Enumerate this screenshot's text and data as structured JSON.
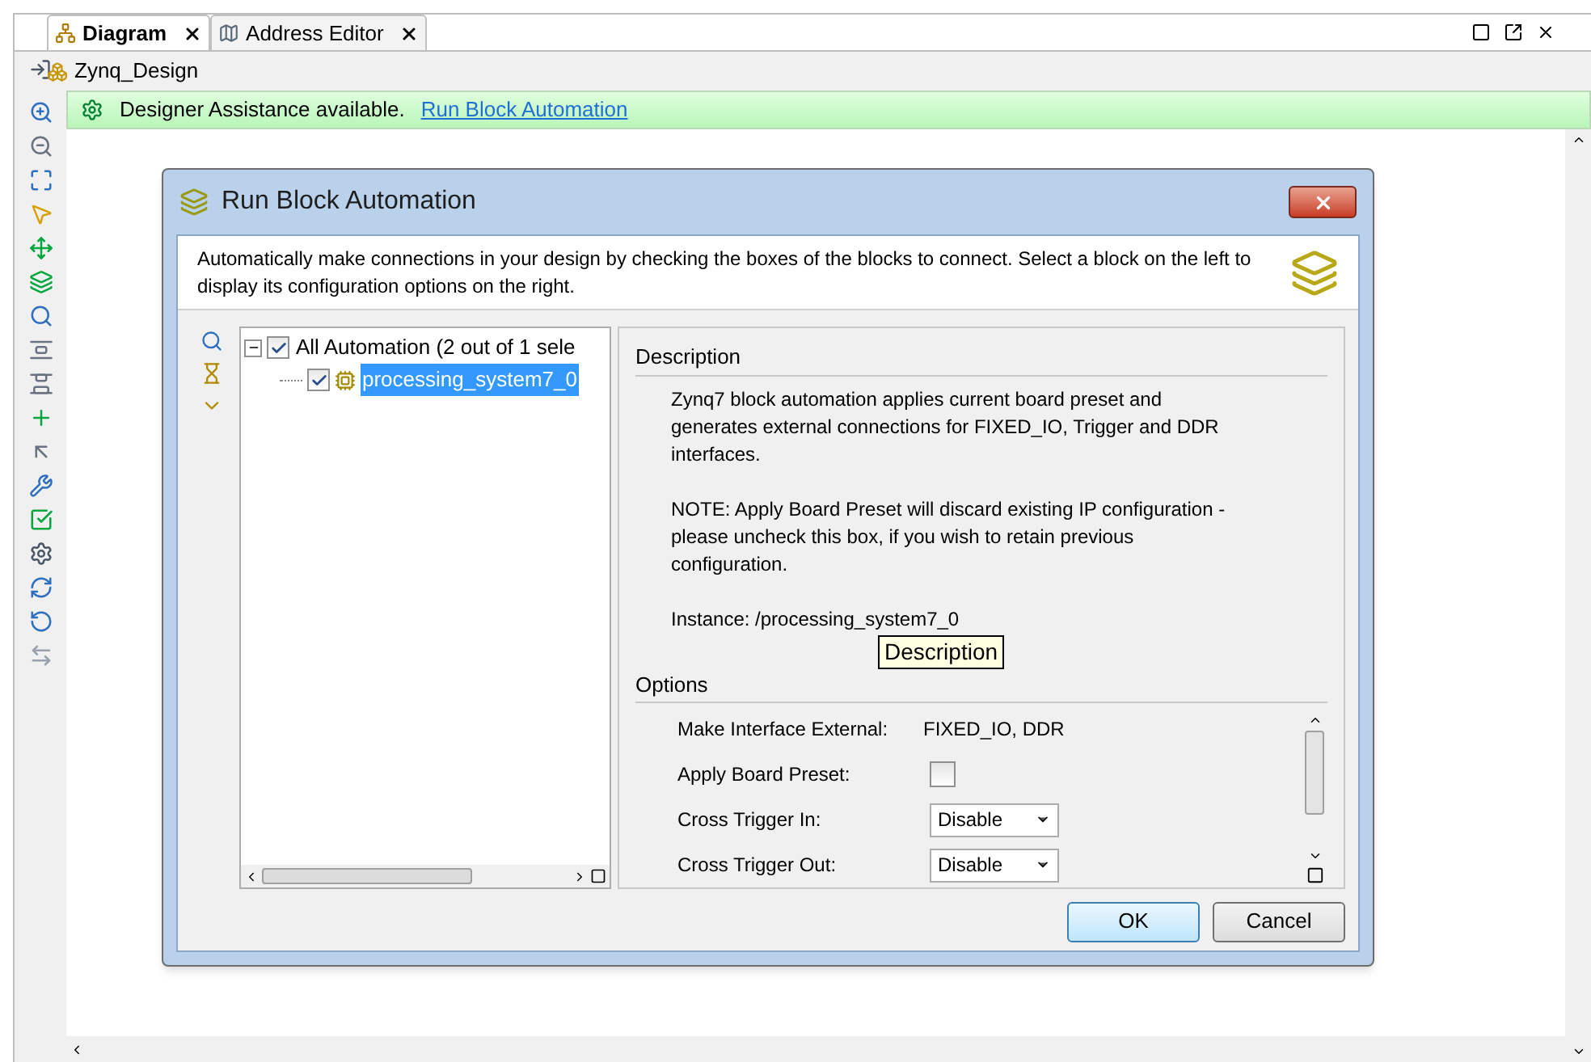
{
  "tabs": [
    {
      "label": "Diagram",
      "selected": true
    },
    {
      "label": "Address Editor",
      "selected": false
    }
  ],
  "breadcrumb": "Zynq_Design",
  "assistance": {
    "text": "Designer Assistance available.",
    "link": "Run Block Automation"
  },
  "dialog": {
    "title": "Run Block Automation",
    "intro": "Automatically make connections in your design by checking the boxes of the blocks to connect. Select a block on the left to display its configuration options on the right.",
    "tree": [
      {
        "label": "All Automation (2 out of 1 sele",
        "checked": true,
        "expanded": true,
        "selected": false,
        "children": [
          {
            "label": "processing_system7_0",
            "checked": true,
            "selected": true
          }
        ]
      }
    ],
    "description_heading": "Description",
    "description": [
      "Zynq7 block automation applies current board preset and generates external connections for FIXED_IO, Trigger and DDR interfaces.",
      "NOTE: Apply Board Preset will discard existing IP configuration - please uncheck this box, if you wish to retain previous configuration.",
      "Instance: /processing_system7_0"
    ],
    "tooltip": "Description",
    "options_heading": "Options",
    "options": [
      {
        "kind": "text",
        "label": "Make Interface External:",
        "value": "FIXED_IO, DDR"
      },
      {
        "kind": "checkbox",
        "label": "Apply Board Preset:",
        "checked": false
      },
      {
        "kind": "dropdown",
        "label": "Cross Trigger In:",
        "value": "Disable"
      },
      {
        "kind": "dropdown",
        "label": "Cross Trigger Out:",
        "value": "Disable"
      }
    ],
    "buttons": [
      {
        "label": "OK",
        "default": true
      },
      {
        "label": "Cancel",
        "default": false
      }
    ]
  }
}
